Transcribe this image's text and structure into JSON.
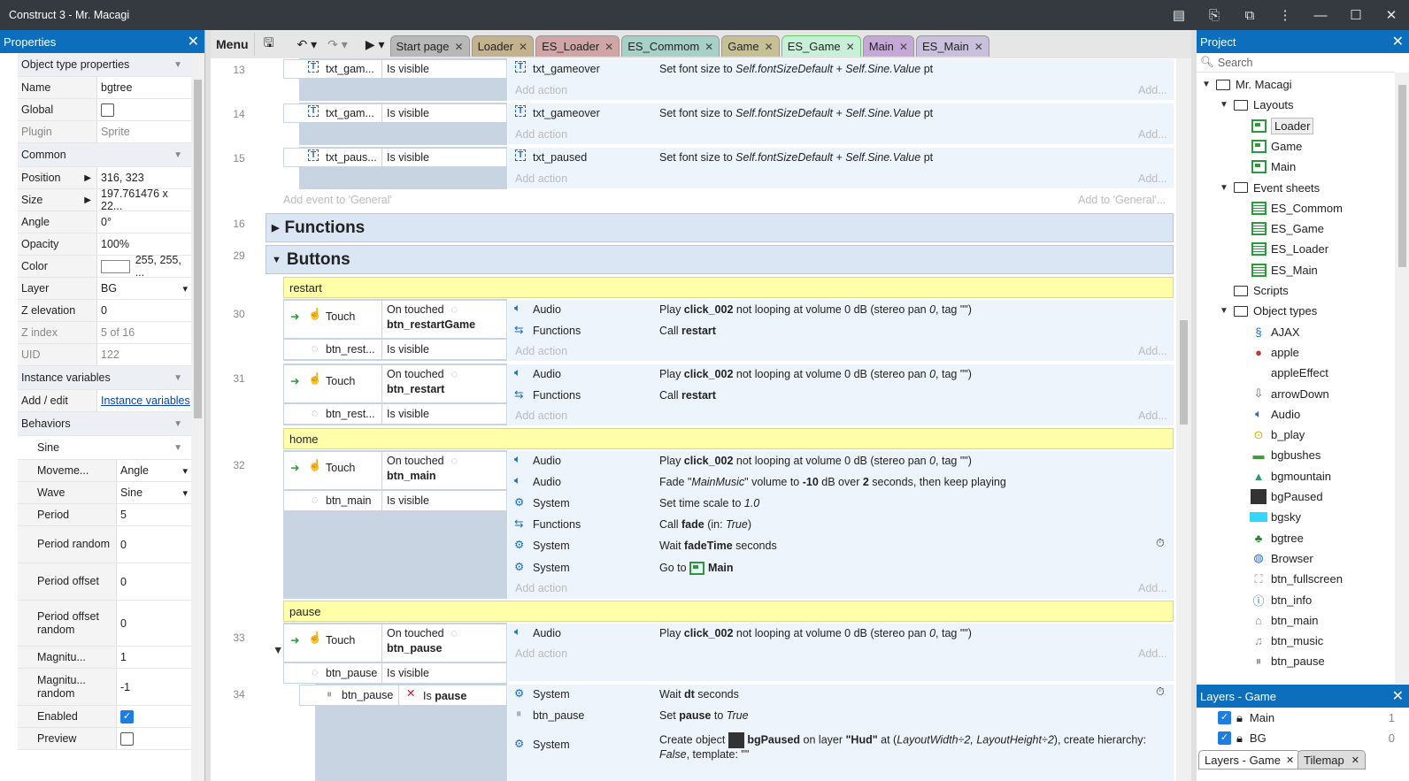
{
  "window": {
    "title": "Construct 3 - Mr. Macagi"
  },
  "properties": {
    "title": "Properties",
    "rows": [
      {
        "k": "Object type properties",
        "type": "sec"
      },
      {
        "k": "Name",
        "v": "bgtree"
      },
      {
        "k": "Global",
        "v": "",
        "check": false
      },
      {
        "k": "Plugin",
        "v": "Sprite",
        "dim": true
      },
      {
        "k": "Common",
        "type": "sec"
      },
      {
        "k": "Position",
        "v": "316, 323",
        "expand": true
      },
      {
        "k": "Size",
        "v": "197.761476 x 22...",
        "expand": true
      },
      {
        "k": "Angle",
        "v": "0°"
      },
      {
        "k": "Opacity",
        "v": "100%"
      },
      {
        "k": "Color",
        "v": "255, 255, ...",
        "swatch": true
      },
      {
        "k": "Layer",
        "v": "BG",
        "select": true
      },
      {
        "k": "Z elevation",
        "v": "0"
      },
      {
        "k": "Z index",
        "v": "5 of 16",
        "dim": true
      },
      {
        "k": "UID",
        "v": "122",
        "dim": true
      },
      {
        "k": "Instance variables",
        "type": "sec"
      },
      {
        "k": "Add / edit",
        "v": "Instance variables",
        "link": true
      },
      {
        "k": "Behaviors",
        "type": "sec"
      },
      {
        "k": "Sine",
        "type": "subsec"
      },
      {
        "k": "Moveme...",
        "v": "Angle",
        "select": true,
        "indent": true
      },
      {
        "k": "Wave",
        "v": "Sine",
        "select": true,
        "indent": true
      },
      {
        "k": "Period",
        "v": "5",
        "indent": true
      },
      {
        "k": "Period random",
        "v": "0",
        "indent": true,
        "tall": true
      },
      {
        "k": "Period offset",
        "v": "0",
        "indent": true,
        "tall": true
      },
      {
        "k": "Period offset random",
        "v": "0",
        "indent": true,
        "tall3": true
      },
      {
        "k": "Magnitu...",
        "v": "1",
        "indent": true
      },
      {
        "k": "Magnitu... random",
        "v": "-1",
        "indent": true,
        "tall": true
      },
      {
        "k": "Enabled",
        "v": "",
        "check": true,
        "indent": true
      },
      {
        "k": "Preview",
        "v": "",
        "check": false,
        "indent": true
      }
    ]
  },
  "toolbar": {
    "menu": "Menu",
    "tabs": [
      {
        "label": "Start page",
        "color": "#b8b8b8"
      },
      {
        "label": "Loader",
        "color": "#c4b28e"
      },
      {
        "label": "ES_Loader",
        "color": "#d1a5a5"
      },
      {
        "label": "ES_Commom",
        "color": "#a6d1c8"
      },
      {
        "label": "Game",
        "color": "#c8c095"
      },
      {
        "label": "ES_Game",
        "color": "#c8f0d8",
        "active": true
      },
      {
        "label": "Main",
        "color": "#c6a8d8"
      },
      {
        "label": "ES_Main",
        "color": "#c8c0dc"
      }
    ]
  },
  "events": {
    "ev13": {
      "num": "13",
      "obj": "txt_gam...",
      "cond": "Is visible",
      "aobj": "txt_gameover",
      "act_pre": "Set font size to ",
      "act_it": "Self.fontSizeDefault + Self.Sine.Value",
      "act_post": " pt"
    },
    "ev14": {
      "num": "14",
      "obj": "txt_gam...",
      "cond": "Is visible",
      "aobj": "txt_gameover",
      "act_pre": "Set font size to ",
      "act_it": "Self.fontSizeDefault + Self.Sine.Value",
      "act_post": " pt"
    },
    "ev15": {
      "num": "15",
      "obj": "txt_paus...",
      "cond": "Is visible",
      "aobj": "txt_paused",
      "act_pre": "Set font size to ",
      "act_it": "Self.fontSizeDefault + Self.Sine.Value",
      "act_post": " pt"
    },
    "add_action": "Add action",
    "add_short": "Add...",
    "add_event": "Add event to 'General'",
    "add_to": "Add to 'General'...",
    "g_functions": {
      "num": "16",
      "label": "Functions"
    },
    "g_buttons": {
      "num": "29",
      "label": "Buttons"
    },
    "c_restart": "restart",
    "c_home": "home",
    "c_pause": "pause",
    "touch": "Touch",
    "on_touched": "On touched",
    "is_visible": "Is visible",
    "ev30": {
      "num": "30",
      "btn": "btn_restartGame",
      "obj2": "btn_rest...",
      "a1o": "Audio",
      "a1": "click_002",
      "a2o": "Functions",
      "a2": "restart"
    },
    "ev31": {
      "num": "31",
      "btn": "btn_restart",
      "obj2": "btn_rest...",
      "a1o": "Audio",
      "a1": "click_002",
      "a2o": "Functions",
      "a2": "restart"
    },
    "play_pre": "Play ",
    "play_post": " not looping at volume 0 dB (stereo pan ",
    "pan": "0",
    ", tag": ", tag \"\")",
    "call": "Call ",
    "ev32": {
      "num": "32",
      "btn": "btn_main",
      "obj2": "btn_main",
      "fade_pre": "Fade \"",
      "fade_it": "MainMusic",
      "fade_mid": "\" volume to ",
      "fade_db": "-10",
      "fade_mid2": " dB over ",
      "fade_sec": "2",
      "fade_post": " seconds, then keep playing",
      "ts_pre": "Set time scale to ",
      "ts": "1.0",
      "fade_call": "fade",
      "fade_in": " (in: ",
      "true": "True",
      "fade_close": ")",
      "wait_pre": "Wait ",
      "wait": "fadeTime",
      "wait_post": " seconds",
      "goto_pre": "Go to ",
      "goto": "Main",
      "o_audio": "Audio",
      "o_system": "System",
      "o_functions": "Functions"
    },
    "ev33": {
      "num": "33",
      "btn": "btn_pause",
      "obj2": "btn_pause"
    },
    "ev34": {
      "num": "34",
      "obj": "btn_pause",
      "cond_pre": "Is ",
      "cond": "pause",
      "wait": "dt",
      "aobj2": "btn_pause",
      "set_pre": "Set ",
      "set_var": "pause",
      "set_mid": " to ",
      "set_val": "True",
      "create_pre": "Create object ",
      "create_obj": "bgPaused",
      "create_mid": " on layer ",
      "create_layer": "\"Hud\"",
      "create_at": " at (",
      "create_xy": "LayoutWidth÷2, LayoutHeight÷2",
      "create_post": "), create hierarchy:",
      "create_l2a": "False",
      "create_l2b": ", template: \"\""
    }
  },
  "project": {
    "title": "Project",
    "search": "Search",
    "tree": [
      {
        "label": "Mr. Macagi",
        "lvl": 0,
        "icon": "folder",
        "arrow": true
      },
      {
        "label": "Layouts",
        "lvl": 1,
        "icon": "folder",
        "arrow": true
      },
      {
        "label": "Loader",
        "lvl": 2,
        "icon": "layout",
        "sel": true
      },
      {
        "label": "Game",
        "lvl": 2,
        "icon": "layout"
      },
      {
        "label": "Main",
        "lvl": 2,
        "icon": "layout"
      },
      {
        "label": "Event sheets",
        "lvl": 1,
        "icon": "folder",
        "arrow": true
      },
      {
        "label": "ES_Commom",
        "lvl": 2,
        "icon": "eventsheet"
      },
      {
        "label": "ES_Game",
        "lvl": 2,
        "icon": "eventsheet"
      },
      {
        "label": "ES_Loader",
        "lvl": 2,
        "icon": "eventsheet"
      },
      {
        "label": "ES_Main",
        "lvl": 2,
        "icon": "eventsheet"
      },
      {
        "label": "Scripts",
        "lvl": 1,
        "icon": "folder"
      },
      {
        "label": "Object types",
        "lvl": 1,
        "icon": "folder",
        "arrow": true
      },
      {
        "label": "AJAX",
        "lvl": 2,
        "icon": "ajax"
      },
      {
        "label": "apple",
        "lvl": 2,
        "icon": "apple"
      },
      {
        "label": "appleEffect",
        "lvl": 2,
        "icon": "none"
      },
      {
        "label": "arrowDown",
        "lvl": 2,
        "icon": "arrow"
      },
      {
        "label": "Audio",
        "lvl": 2,
        "icon": "audio"
      },
      {
        "label": "b_play",
        "lvl": 2,
        "icon": "play"
      },
      {
        "label": "bgbushes",
        "lvl": 2,
        "icon": "bushes"
      },
      {
        "label": "bgmountain",
        "lvl": 2,
        "icon": "mountain"
      },
      {
        "label": "bgPaused",
        "lvl": 2,
        "icon": "paused"
      },
      {
        "label": "bgsky",
        "lvl": 2,
        "icon": "sky"
      },
      {
        "label": "bgtree",
        "lvl": 2,
        "icon": "tree"
      },
      {
        "label": "Browser",
        "lvl": 2,
        "icon": "browser"
      },
      {
        "label": "btn_fullscreen",
        "lvl": 2,
        "icon": "fullscreen"
      },
      {
        "label": "btn_info",
        "lvl": 2,
        "icon": "info"
      },
      {
        "label": "btn_main",
        "lvl": 2,
        "icon": "main"
      },
      {
        "label": "btn_music",
        "lvl": 2,
        "icon": "music"
      },
      {
        "label": "btn_pause",
        "lvl": 2,
        "icon": "pause"
      }
    ]
  },
  "layers": {
    "title": "Layers - Game",
    "rows": [
      {
        "name": "Main",
        "n": "1"
      },
      {
        "name": "BG",
        "n": "0"
      }
    ],
    "tab1": "Layers - Game",
    "tab2": "Tilemap"
  }
}
